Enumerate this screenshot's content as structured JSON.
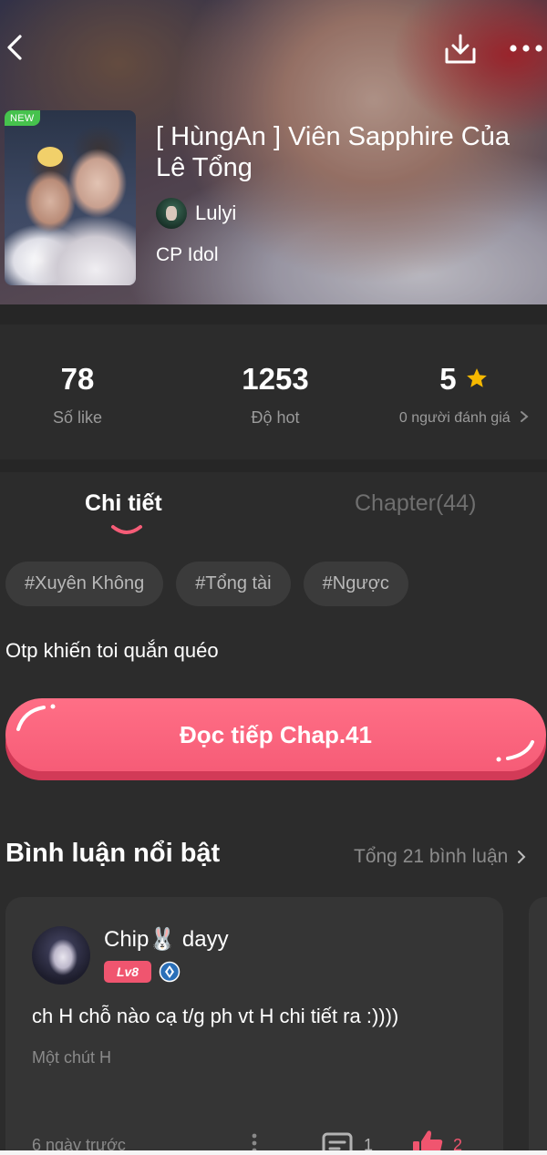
{
  "badge": "NEW",
  "story": {
    "title": "[ HùngAn ] Viên Sapphire Của Lê Tổng",
    "author": "Lulyi",
    "category": "CP Idol"
  },
  "stats": {
    "likes_value": "78",
    "likes_label": "Số like",
    "hot_value": "1253",
    "hot_label": "Độ hot",
    "rating_value": "5",
    "rating_label": "0 người đánh giá"
  },
  "tabs": {
    "details": "Chi tiết",
    "chapters": "Chapter(44)"
  },
  "tags": [
    "#Xuyên Không",
    "#Tổng tài",
    "#Ngược"
  ],
  "description": "Otp khiến toi quắn quéo",
  "read_button": "Đọc tiếp Chap.41",
  "comments": {
    "heading": "Bình luận nổi bật",
    "total": "Tổng 21 bình luận",
    "items": [
      {
        "user": "Chip🐰 dayy",
        "level": "Lv8",
        "text": "ch H chỗ nào cạ t/g ph vt H chi tiết ra :))))",
        "chapter": "Một chút H",
        "time": "6 ngày trước",
        "replies": "1",
        "likes": "2"
      }
    ]
  },
  "icons": {
    "back": "chevron-left-icon",
    "download": "download-icon",
    "more": "more-horizontal-icon",
    "star": "star-icon",
    "chevron_right": "chevron-right-icon",
    "verify": "verified-icon",
    "reply": "comment-icon",
    "like": "thumbs-up-icon"
  },
  "colors": {
    "accent": "#f65c77",
    "background": "#262626",
    "card": "#353535",
    "new_badge": "#46c24d",
    "star": "#f5b800"
  }
}
